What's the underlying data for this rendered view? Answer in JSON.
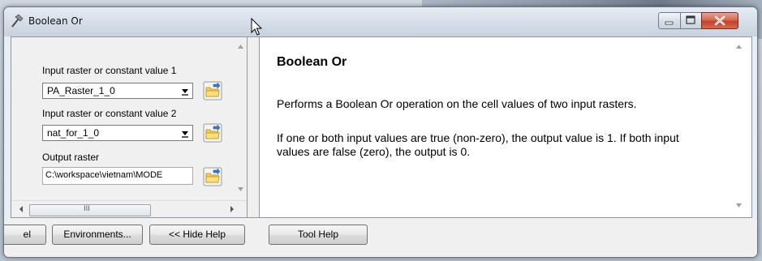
{
  "window": {
    "title": "Boolean Or"
  },
  "params": [
    {
      "label": "Input raster or constant value 1",
      "value": "PA_Raster_1_0"
    },
    {
      "label": "Input raster or constant value 2",
      "value": "nat_for_1_0"
    },
    {
      "label": "Output raster",
      "value": "C:\\workspace\\vietnam\\MODE"
    }
  ],
  "scroll": {
    "hthumb_grip": "III"
  },
  "help": {
    "title": "Boolean Or",
    "p1": "Performs a Boolean Or operation on the cell values of two input rasters.",
    "p2": "If one or both input values are true (non-zero), the output value is 1. If both input values are false (zero), the output is 0."
  },
  "buttons": {
    "cancel": "el",
    "environments": "Environments...",
    "hide_help": "<< Hide Help",
    "tool_help": "Tool Help"
  },
  "colors": {
    "title_bar": "#d4dde8",
    "close_button": "#c2402a",
    "panel": "#f0f0f0"
  }
}
